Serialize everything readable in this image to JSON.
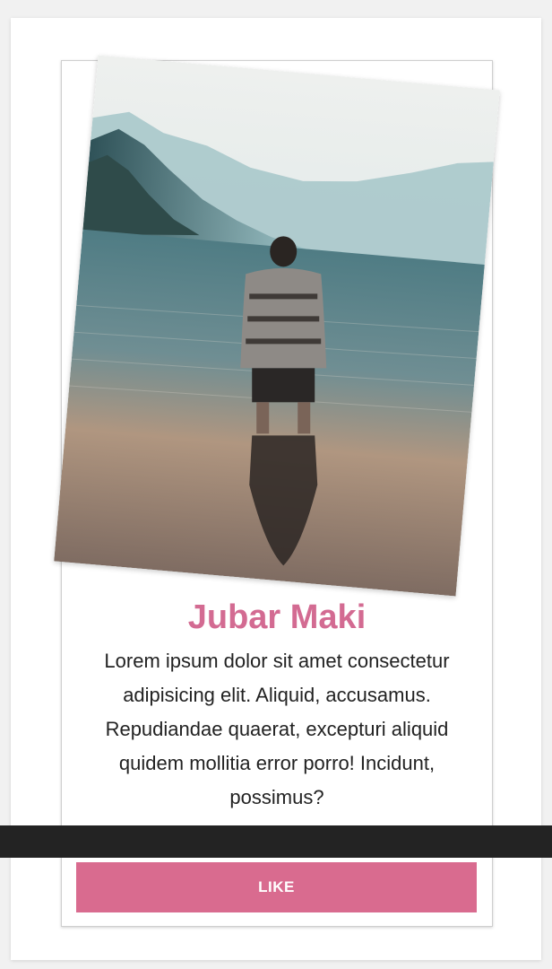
{
  "profile": {
    "name": "Jubar Maki",
    "description": "Lorem ipsum dolor sit amet consectetur adipisicing elit. Aliquid, accusamus. Repudiandae quaerat, excepturi aliquid quidem mollitia error porro! Incidunt, possimus?",
    "like_label": "LIKE"
  },
  "colors": {
    "accent": "#d96b8f",
    "name_text": "#d36b92",
    "overlay_bar": "#232323"
  }
}
